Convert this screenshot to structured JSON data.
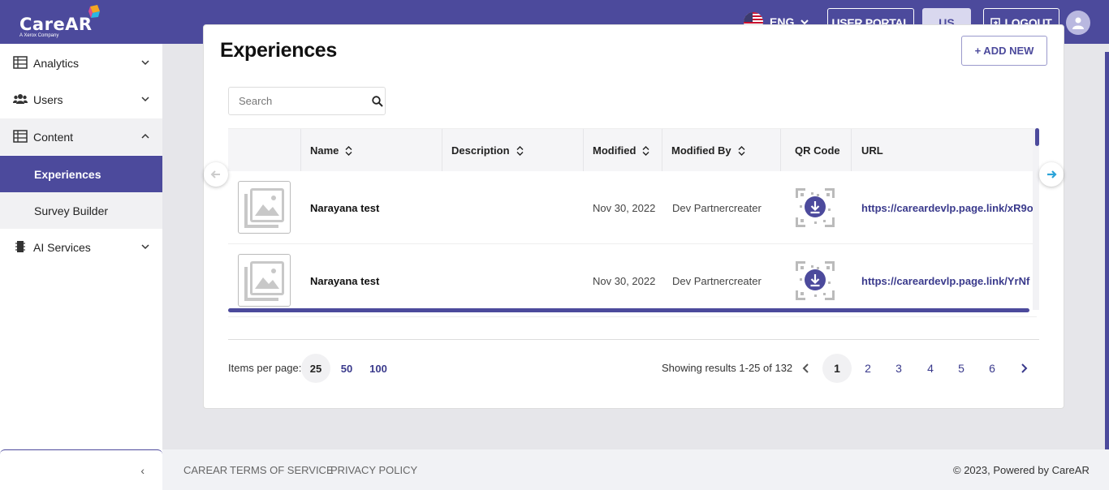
{
  "header": {
    "logo_text": "CareAR",
    "logo_sub": "A Xerox Company",
    "language": "ENG",
    "user_portal": "USER PORTAL",
    "region": "US",
    "logout": "LOGOUT"
  },
  "sidebar": {
    "items": [
      {
        "label": "Analytics",
        "icon": "table-icon"
      },
      {
        "label": "Users",
        "icon": "users-icon"
      },
      {
        "label": "Content",
        "icon": "table-icon"
      },
      {
        "label": "Experiences",
        "icon": ""
      },
      {
        "label": "Survey Builder",
        "icon": ""
      },
      {
        "label": "AI Services",
        "icon": "chip-icon"
      }
    ],
    "collapse": "‹"
  },
  "main": {
    "title": "Experiences",
    "add_new": "+   ADD NEW",
    "search_placeholder": "Search",
    "columns": [
      "Name",
      "Description",
      "Modified",
      "Modified By",
      "QR Code",
      "URL"
    ],
    "rows": [
      {
        "name": "Narayana test",
        "description": "",
        "modified": "Nov 30, 2022",
        "modified_by": "Dev Partnercreater",
        "url": "https://careardevlp.page.link/xR9o"
      },
      {
        "name": "Narayana test",
        "description": "",
        "modified": "Nov 30, 2022",
        "modified_by": "Dev Partnercreater",
        "url": "https://careardevlp.page.link/YrNf"
      }
    ],
    "items_per_page_label": "Items per page:",
    "items_per_page": [
      "25",
      "50",
      "100"
    ],
    "selected_items_per_page": "25",
    "showing": "Showing results 1-25 of 132",
    "pages": [
      "1",
      "2",
      "3",
      "4",
      "5",
      "6"
    ],
    "current_page": "1"
  },
  "footer": {
    "links": [
      "CAREAR",
      "TERMS OF SERVICE",
      "PRIVACY POLICY"
    ],
    "copyright": "© 2023, Powered by CareAR"
  },
  "colors": {
    "brand": "#4c4a9c",
    "accent_light": "#d9d8ef",
    "link": "#3a3a8c"
  }
}
